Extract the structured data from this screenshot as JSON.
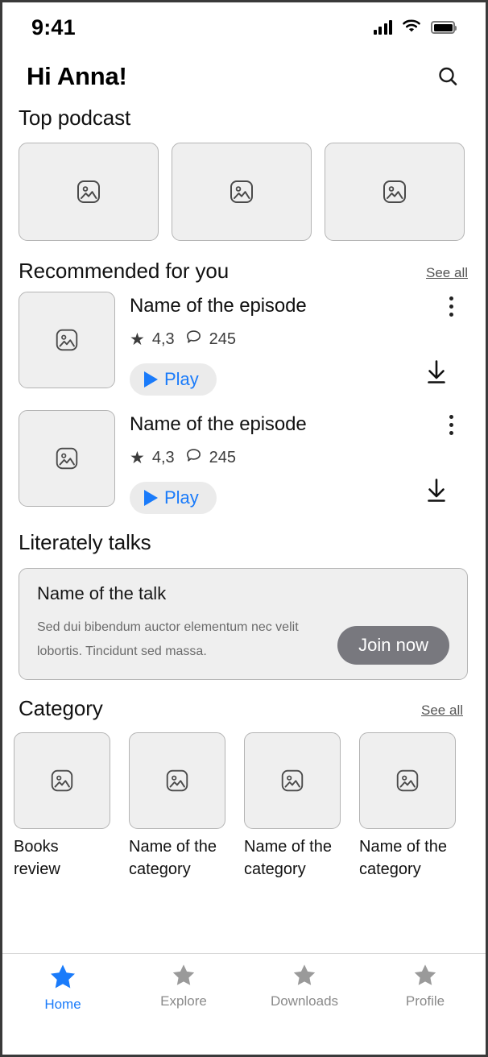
{
  "theme": {
    "accent": "#1a7bfa",
    "card_bg": "#efefef",
    "card_border": "#b4b4b4",
    "muted_text": "#6b6b6b",
    "join_button_bg": "#78787e"
  },
  "status_bar": {
    "time": "9:41",
    "icons": [
      "cellular-signal-icon",
      "wifi-icon",
      "battery-icon"
    ]
  },
  "header": {
    "greeting": "Hi Anna!",
    "search_icon": "search-icon"
  },
  "top_podcast": {
    "title": "Top podcast",
    "cards": [
      {
        "placeholder_icon": "image-placeholder-icon"
      },
      {
        "placeholder_icon": "image-placeholder-icon"
      },
      {
        "placeholder_icon": "image-placeholder-icon"
      }
    ]
  },
  "recommended": {
    "title": "Recommended for you",
    "see_all": "See all",
    "episodes": [
      {
        "title": "Name of the episode",
        "rating_icon": "star-icon",
        "rating": "4,3",
        "comments_icon": "comment-bubble-icon",
        "comments": "245",
        "play_label": "Play",
        "play_icon": "play-triangle-icon",
        "download_icon": "download-arrow-icon",
        "menu_icon": "kebab-menu-icon",
        "placeholder_icon": "image-placeholder-icon"
      },
      {
        "title": "Name of the episode",
        "rating_icon": "star-icon",
        "rating": "4,3",
        "comments_icon": "comment-bubble-icon",
        "comments": "245",
        "play_label": "Play",
        "play_icon": "play-triangle-icon",
        "download_icon": "download-arrow-icon",
        "menu_icon": "kebab-menu-icon",
        "placeholder_icon": "image-placeholder-icon"
      }
    ]
  },
  "talks": {
    "title": "Literately talks",
    "card": {
      "title": "Name of the talk",
      "description": "Sed dui bibendum auctor elementum nec velit lobortis. Tincidunt sed massa.",
      "button_label": "Join now"
    }
  },
  "category": {
    "title": "Category",
    "see_all": "See all",
    "items": [
      {
        "label": "Books\nreview",
        "placeholder_icon": "image-placeholder-icon"
      },
      {
        "label": "Name of the\ncategory",
        "placeholder_icon": "image-placeholder-icon"
      },
      {
        "label": "Name of the\ncategory",
        "placeholder_icon": "image-placeholder-icon"
      },
      {
        "label": "Name of the\ncategory",
        "placeholder_icon": "image-placeholder-icon"
      }
    ]
  },
  "tabbar": {
    "tabs": [
      {
        "label": "Home",
        "icon": "star-icon",
        "active": true
      },
      {
        "label": "Explore",
        "icon": "star-icon",
        "active": false
      },
      {
        "label": "Downloads",
        "icon": "star-icon",
        "active": false
      },
      {
        "label": "Profile",
        "icon": "star-icon",
        "active": false
      }
    ]
  }
}
